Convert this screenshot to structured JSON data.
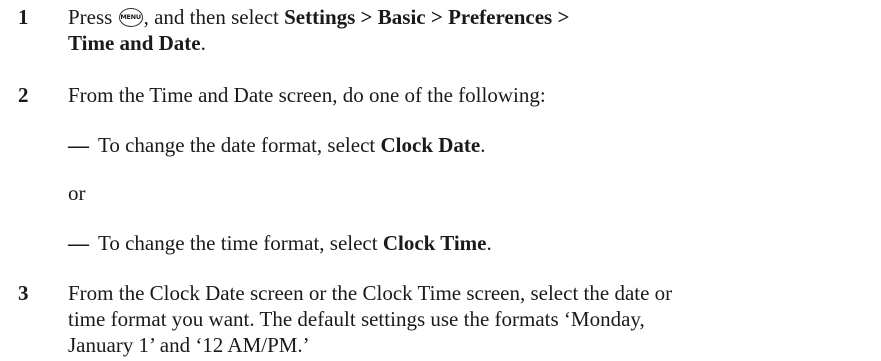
{
  "steps": [
    {
      "number": "1",
      "press": "Press",
      "menu_icon": {
        "name": "menu-button-icon",
        "label": "MENU"
      },
      "after_icon": ", and then select",
      "path": "Settings > Basic > Preferences >",
      "path_end": "Time and Date",
      "period": "."
    },
    {
      "number": "2",
      "text": "From the Time and Date screen, do one of the following:",
      "options": [
        {
          "dash": "—",
          "prefix": "To change the date format, select",
          "target": "Clock Date",
          "suffix": "."
        },
        {
          "dash": "—",
          "prefix": "To change the time format, select",
          "target": "Clock Time",
          "suffix": "."
        }
      ],
      "or": "or"
    },
    {
      "number": "3",
      "lines": [
        "From the Clock Date screen or the Clock Time screen, select the date or",
        "time format you want. The default settings use the formats ‘Monday,",
        "January 1’ and ‘12 AM/PM.’"
      ]
    }
  ]
}
